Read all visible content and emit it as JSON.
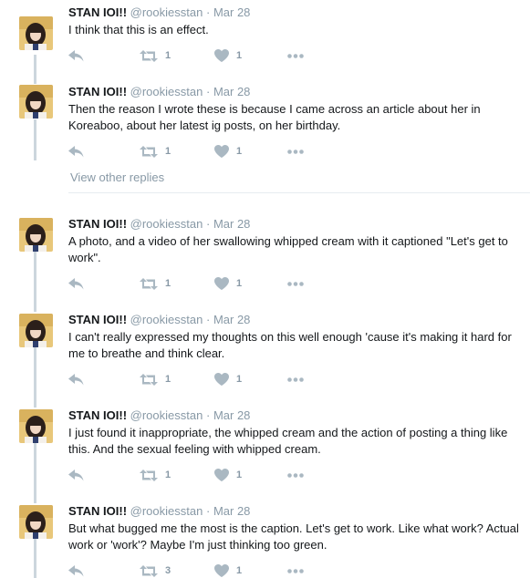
{
  "tweets": [
    {
      "name": "STAN IOI!!",
      "handle": "@rookiesstan",
      "sep": "·",
      "date": "Mar 28",
      "text": "I think that this is an effect.",
      "retweets": "1",
      "likes": "1"
    },
    {
      "name": "STAN IOI!!",
      "handle": "@rookiesstan",
      "sep": "·",
      "date": "Mar 28",
      "text": "Then the reason I wrote these is because I came across an article about her in Koreaboo, about her latest ig posts, on her birthday.",
      "retweets": "1",
      "likes": "1"
    },
    {
      "name": "STAN IOI!!",
      "handle": "@rookiesstan",
      "sep": "·",
      "date": "Mar 28",
      "text": "A photo, and a video of her swallowing whipped cream with it captioned \"Let's get to work\".",
      "retweets": "1",
      "likes": "1"
    },
    {
      "name": "STAN IOI!!",
      "handle": "@rookiesstan",
      "sep": "·",
      "date": "Mar 28",
      "text": "I can't really expressed my thoughts on this well enough 'cause it's making it hard for me to breathe and think clear.",
      "retweets": "1",
      "likes": "1"
    },
    {
      "name": "STAN IOI!!",
      "handle": "@rookiesstan",
      "sep": "·",
      "date": "Mar 28",
      "text": "I just found it inappropriate, the whipped cream and the action of posting a thing like this. And the sexual feeling with whipped cream.",
      "retweets": "1",
      "likes": "1"
    },
    {
      "name": "STAN IOI!!",
      "handle": "@rookiesstan",
      "sep": "·",
      "date": "Mar 28",
      "text": "But what bugged me the most is the caption. Let's get to work. Like what work? Actual work or 'work'? Maybe I'm just thinking too green.",
      "retweets": "3",
      "likes": "1"
    }
  ],
  "view_other_replies": "View other replies",
  "icons": {
    "reply": "reply-icon",
    "retweet": "retweet-icon",
    "like": "heart-icon",
    "more": "more-icon"
  },
  "colors": {
    "action_icon": "#aab8c2",
    "meta_text": "#8899a6",
    "thread_line": "#ccd6dd"
  }
}
